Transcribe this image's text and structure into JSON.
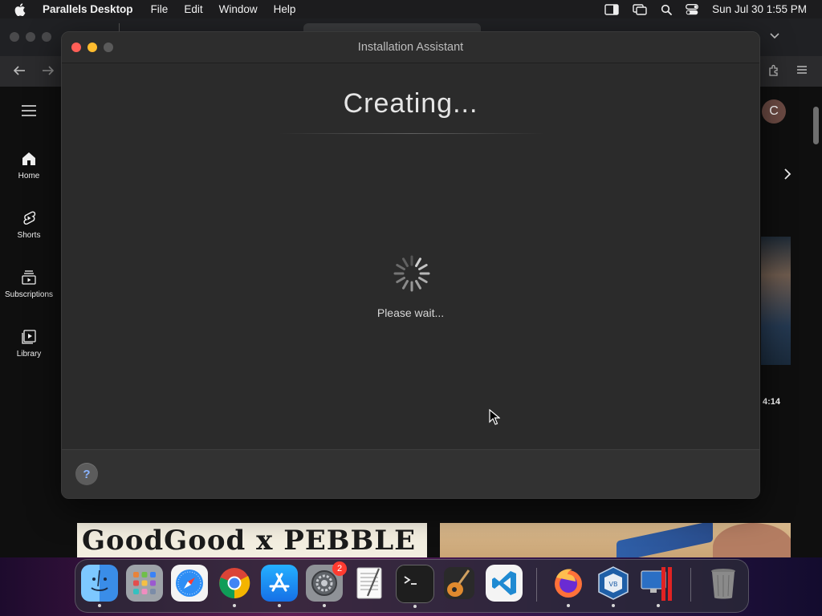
{
  "menubar": {
    "app_name": "Parallels Desktop",
    "items": [
      "File",
      "Edit",
      "Window",
      "Help"
    ],
    "clock": "Sun Jul 30  1:55 PM"
  },
  "youtube": {
    "sidebar": [
      {
        "label": "Home",
        "icon": "home-icon"
      },
      {
        "label": "Shorts",
        "icon": "shorts-icon"
      },
      {
        "label": "Subscriptions",
        "icon": "subscriptions-icon"
      },
      {
        "label": "Library",
        "icon": "library-icon"
      }
    ],
    "avatar_letter": "C",
    "video_duration": "4:14",
    "banner_left_text": "GoodGood x PEBBLE"
  },
  "window": {
    "title": "Installation Assistant",
    "heading": "Creating...",
    "status": "Please wait...",
    "help_label": "?"
  },
  "dock": {
    "apps": [
      "Finder",
      "Launchpad",
      "Safari",
      "Google Chrome",
      "App Store",
      "System Settings",
      "TextEdit",
      "Terminal",
      "GarageBand",
      "Visual Studio Code",
      "Firefox",
      "VirtualBox",
      "Parallels Desktop",
      "Trash"
    ],
    "settings_badge": "2"
  },
  "colors": {
    "window_bg": "#2b2b2b",
    "close": "#ff5f57",
    "minimize": "#febc2e",
    "zoom_inactive": "#5a5a5a"
  }
}
